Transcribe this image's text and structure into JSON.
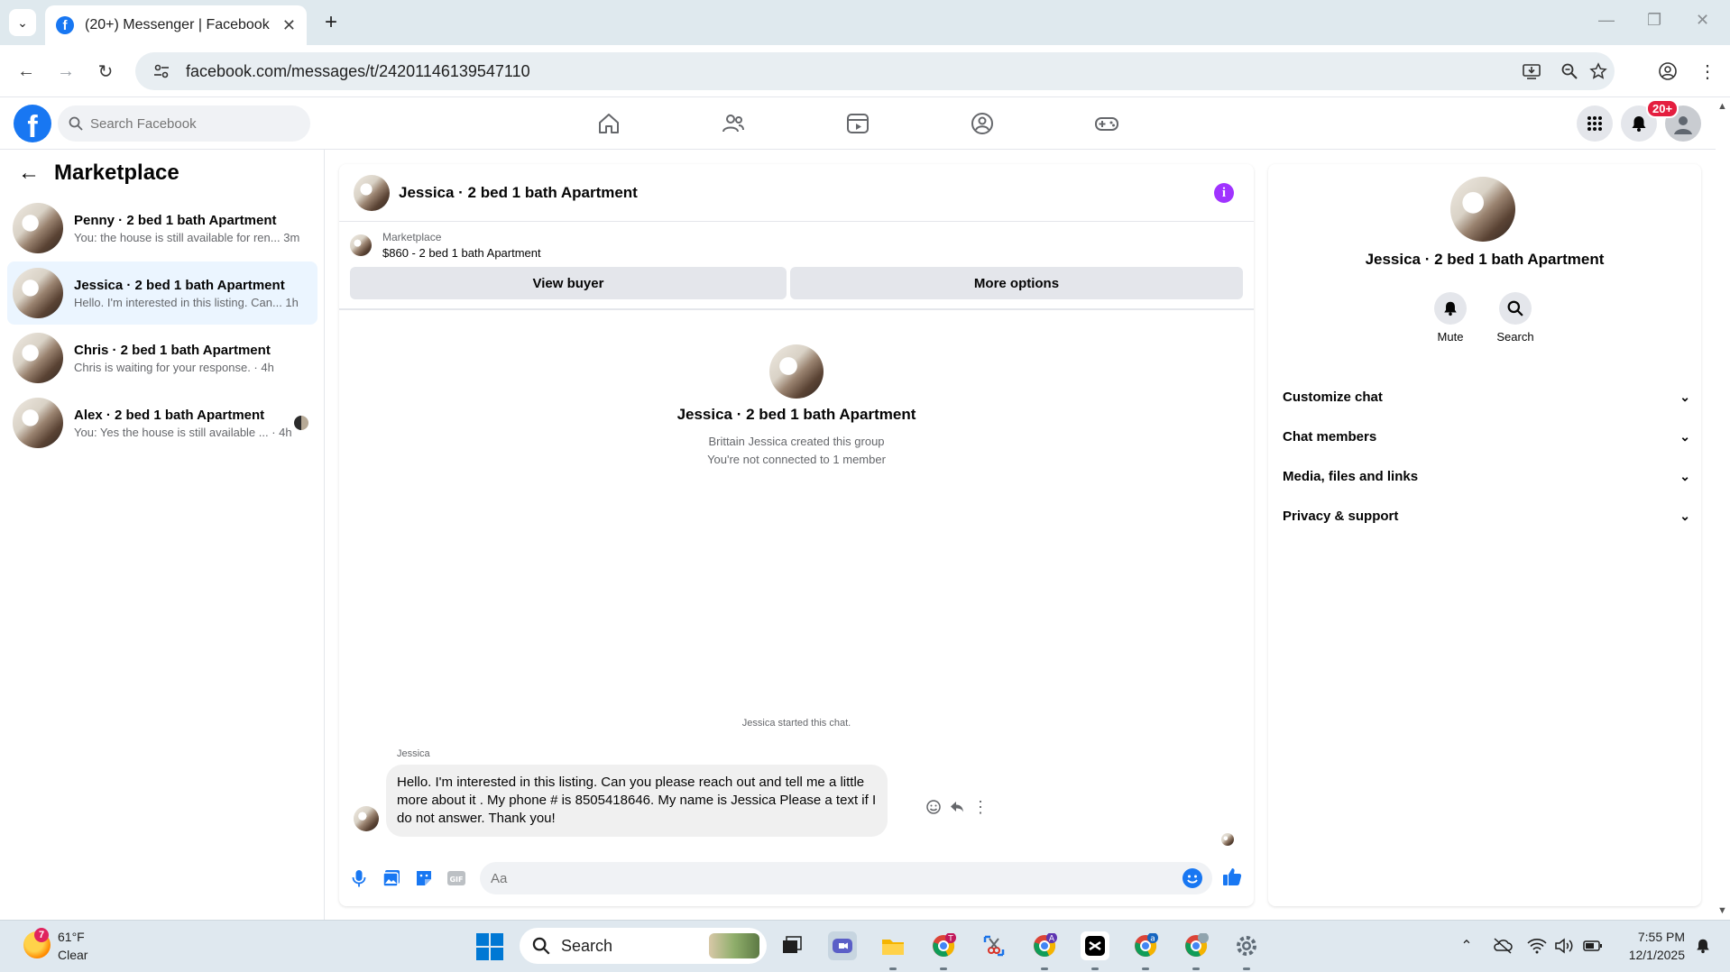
{
  "browser": {
    "tab_title": "(20+) Messenger | Facebook",
    "url": "facebook.com/messages/t/24201146139547110",
    "new_tab_icon": "plus-icon"
  },
  "fb": {
    "search_placeholder": "Search Facebook",
    "notif_badge": "20+",
    "brand_color": "#1877f2"
  },
  "sidebar": {
    "title": "Marketplace",
    "conversations": [
      {
        "name": "Penny · 2 bed 1 bath Apartment",
        "preview": "You: the house is still available for ren... 3m"
      },
      {
        "name": "Jessica · 2 bed 1 bath Apartment",
        "preview": "Hello. I'm interested in this listing. Can... 1h"
      },
      {
        "name": "Chris · 2 bed 1 bath Apartment",
        "preview": "Chris is waiting for your response. · 4h"
      },
      {
        "name": "Alex · 2 bed 1 bath Apartment",
        "preview": "You: Yes the house is still available ... · 4h"
      }
    ]
  },
  "chat": {
    "title": "Jessica · 2 bed 1 bath Apartment",
    "marketplace_label": "Marketplace",
    "listing": "$860 - 2 bed 1 bath Apartment",
    "view_buyer": "View buyer",
    "more_options": "More options",
    "group_name": "Jessica · 2 bed 1 bath Apartment",
    "created": "Brittain Jessica created this group",
    "connection": "You're not connected to 1 member",
    "started": "Jessica started this chat.",
    "sender": "Jessica",
    "message": "Hello. I'm interested in this listing. Can you please reach out and tell me a little more about it . My phone # is 8505418646. My name is Jessica Please a text if I do not answer. Thank you!",
    "composer_placeholder": "Aa"
  },
  "details": {
    "name": "Jessica · 2 bed 1 bath Apartment",
    "mute": "Mute",
    "search": "Search",
    "sections": [
      "Customize chat",
      "Chat members",
      "Media, files and links",
      "Privacy & support"
    ]
  },
  "taskbar": {
    "weather_badge": "7",
    "temperature": "61°F",
    "condition": "Clear",
    "search": "Search",
    "time": "7:55 PM",
    "date": "12/1/2025"
  }
}
